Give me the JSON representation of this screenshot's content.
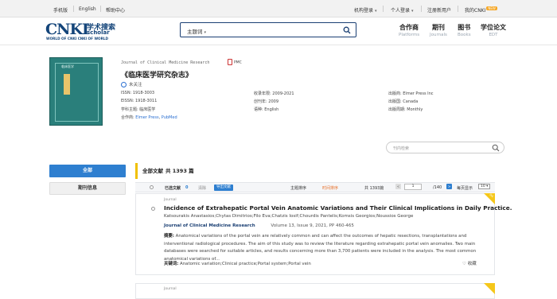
{
  "topbar": {
    "left_links": [
      "手机版",
      "English",
      "帮助中心"
    ],
    "institution_login": "机构登录",
    "personal_login": "个人登录",
    "register": "注册新用户",
    "my_cnki": "我的CNKI",
    "new_badge": "NEW"
  },
  "logo": {
    "mark": "CNKI",
    "cn": "学术搜索",
    "en": "scholar",
    "tagline": "WORLD OF CNKI CNKI OF WORLD"
  },
  "search": {
    "scope": "主题词",
    "value": "",
    "placeholder": ""
  },
  "nav": [
    {
      "label": "合作商",
      "sub": "Platforms"
    },
    {
      "label": "期刊",
      "sub": "Journals"
    },
    {
      "label": "图书",
      "sub": "Books"
    },
    {
      "label": "学位论文",
      "sub": "EDT"
    }
  ],
  "journal": {
    "cover_title": "临床医学",
    "english_title": "Journal of Clinical Medicine Research",
    "pmc_label": "PMC",
    "chinese_title": "《临床医学研究杂志》",
    "follow": "未关注",
    "issn": "ISSN: 1918-3003",
    "eissn": "EISSN: 1918-3011",
    "subject": "学科主题: 临床医学",
    "partners_label": "合作商:",
    "partner_1": "Elmer Press",
    "partner_2": "PubMed",
    "years": "收录年限: 2009-2021",
    "founded": "创刊年: 2009",
    "language": "语种: English",
    "publisher": "出版商: Elmer Press Inc",
    "country": "出版国: Canada",
    "frequency": "出版周期: Monthly"
  },
  "journal_search": {
    "placeholder": "刊内检索"
  },
  "sidebar": {
    "all_label": "全部",
    "info_label": "期刊信息"
  },
  "results": {
    "all_docs": "全部文献",
    "total_label": "共 1393 篇"
  },
  "toolbar": {
    "selected": "已选文献",
    "selected_count": "0",
    "clear": "清除",
    "export": "导出文献",
    "sort_relevance": "主题排序",
    "sort_time": "时间排序",
    "count": "共 1393篇",
    "page_current": "1",
    "page_total": "/140",
    "prev": "<",
    "next": ">",
    "per_page_label": "每页显示",
    "per_page_value": "10"
  },
  "article": {
    "type": "Journal",
    "title": "Incidence of Extrahepatic Portal Vein Anatomic Variations and Their Clinical Implications in Daily Practice.",
    "authors": "Katsourakis Anastasios;Chytas Dimitrios;Filo Eva;Chatzis Iosif;Chourdis Pantelis;Komsis Georgios;Noussios George",
    "journal": "Journal of Clinical Medicine Research",
    "volume": "Volume 13, Issue 9, 2021, PP 460-465",
    "abstract_label": "摘要:",
    "abstract": "Anatomical variations of the portal vein are relatively common and can affect the outcomes of hepatic resections, transplantations and interventional radiological procedures. The aim of this study was to review the literature regarding extrahepatic portal vein anomalies. Two main databases were searched for suitable articles, and results concerning more than 3,700 patients were included in the analysis. The most common anatomical variations of...",
    "keywords_label": "关键词:",
    "keywords": "Anatomic variation;Clinical practice;Portal system;Portal vein",
    "favorite": "收藏",
    "badge": "OA"
  },
  "article2": {
    "type": "Journal"
  }
}
